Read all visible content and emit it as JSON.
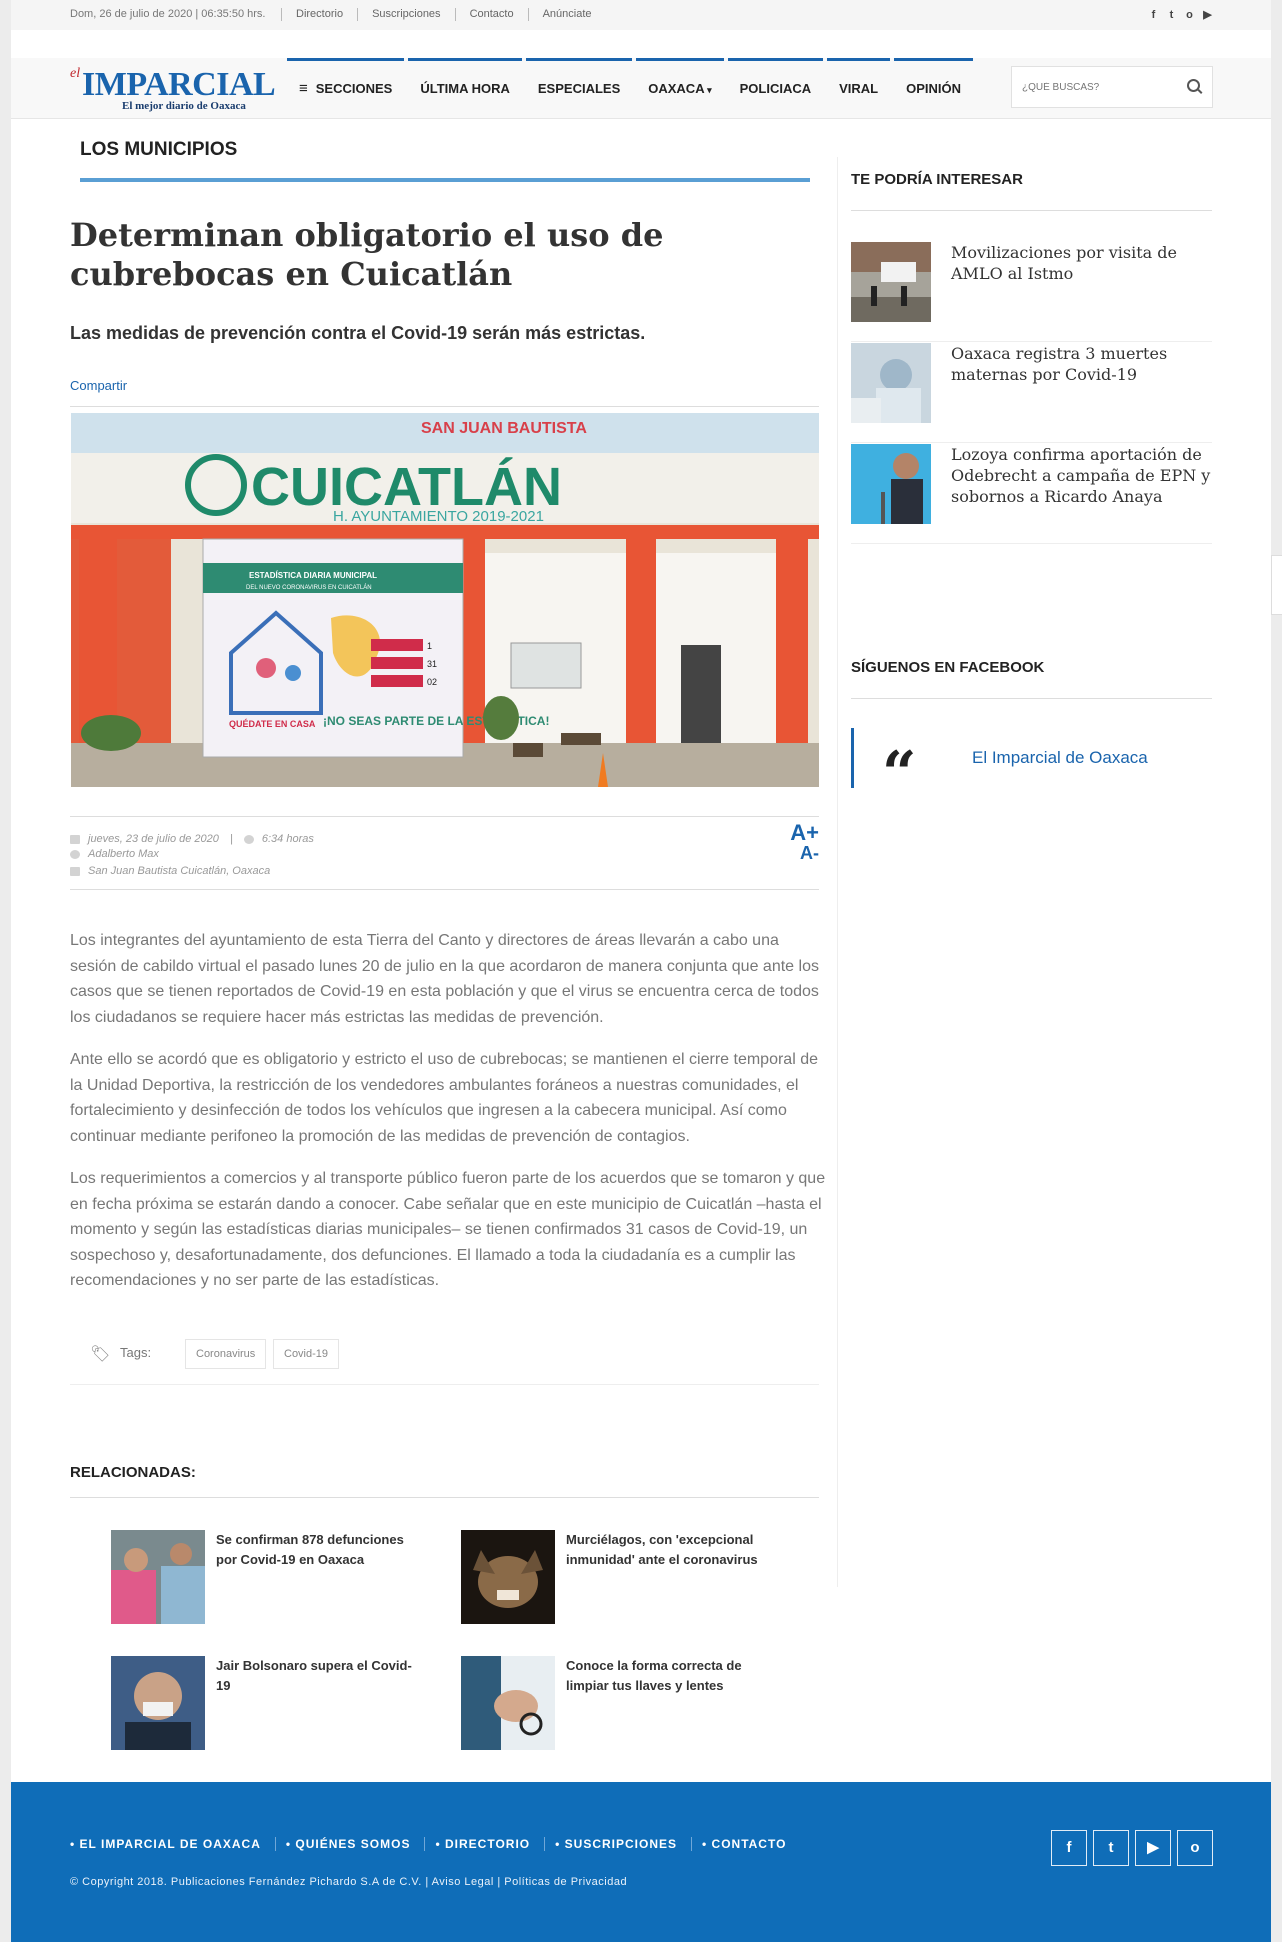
{
  "topbar": {
    "date": "Dom, 26 de julio de 2020 | 06:35:50 hrs.",
    "links": [
      "Directorio",
      "Suscripciones",
      "Contacto",
      "Anúnciate"
    ],
    "social": [
      "f",
      "t",
      "o",
      "▶"
    ]
  },
  "header": {
    "logo_prefix": "el",
    "logo": "IMPARCIAL",
    "tagline": "El mejor diario de Oaxaca",
    "nav": [
      "SECCIONES",
      "ÚLTIMA HORA",
      "ESPECIALES",
      "OAXACA",
      "POLICIACA",
      "VIRAL",
      "OPINIÓN"
    ],
    "search_placeholder": "¿QUÉ BUSCAS?"
  },
  "article": {
    "section": "LOS MUNICIPIOS",
    "title": "Determinan obligatorio el uso de cubrebocas en Cuicatlán",
    "subtitle": "Las medidas de prevención contra el Covid-19 serán más estrictas.",
    "share": "Compartir",
    "hero": {
      "banner_top": "SAN JUAN BAUTISTA",
      "banner_main": "CUICATLÁN",
      "banner_sub": "H. AYUNTAMIENTO 2019-2021",
      "poster_title": "ESTADÍSTICA DIARIA MUNICIPAL",
      "poster_sub": "DEL NUEVO CORONAVIRUS EN CUICATLÁN",
      "poster_slogan": "¡NO SEAS PARTE DE LA ESTADÍSTICA!",
      "poster_home": "QUÉDATE EN CASA",
      "poster_n1": "1",
      "poster_n2": "31",
      "poster_n3": "02"
    },
    "date": "jueves, 23 de julio de 2020",
    "time": "6:34 horas",
    "author": "Adalberto Max",
    "location": "San Juan Bautista Cuicatlán, Oaxaca",
    "font_plus": "A+",
    "font_minus": "A-",
    "paragraphs": [
      "Los integrantes del ayuntamiento de esta Tierra del Canto y directores de áreas llevarán a cabo una sesión de cabildo virtual el pasado lunes 20 de julio en la que acordaron de manera conjunta que ante los casos que se tienen reportados de Covid-19 en esta población y que el virus se encuentra cerca de todos los ciudadanos se requiere hacer más estrictas las medidas de prevención.",
      "Ante ello se acordó que es obligatorio y estricto el uso de cubrebocas; se mantienen el cierre temporal de la Unidad Deportiva, la restricción de los vendedores ambulantes foráneos a nuestras comunidades, el fortalecimiento y desinfección de todos los vehículos que ingresen a la cabecera municipal. Así como continuar mediante perifoneo la promoción de las medidas de prevención de contagios.",
      "Los requerimientos a comercios y al transporte público fueron parte de los acuerdos que se tomaron y que en fecha próxima se estarán dando a conocer. Cabe señalar que en este municipio de Cuicatlán –hasta el momento y según las estadísticas diarias municipales– se tienen confirmados 31 casos de Covid-19, un sospechoso y, desafortunadamente, dos defunciones. El llamado a toda la ciudadanía es a cumplir las recomendaciones y no ser parte de las estadísticas."
    ],
    "tags_label": "Tags:",
    "tags": [
      "Coronavirus",
      "Covid-19"
    ]
  },
  "related": {
    "title": "RELACIONADAS:",
    "items": [
      "Se confirman 878 defunciones por Covid-19 en Oaxaca",
      "Murciélagos, con 'excepcional inmunidad' ante el coronavirus",
      "Jair Bolsonaro supera el Covid-19",
      "Conoce la forma correcta de limpiar tus llaves y lentes"
    ]
  },
  "sidebar": {
    "interest_title": "TE PODRÍA INTERESAR",
    "items": [
      "Movilizaciones por visita de AMLO al Istmo",
      "Oaxaca registra 3 muertes maternas por Covid-19",
      "Lozoya confirma aportación de Odebrecht a campaña de EPN y sobornos a Ricardo Anaya"
    ],
    "facebook_title": "SÍGUENOS EN FACEBOOK",
    "facebook_name": "El Imparcial de Oaxaca"
  },
  "footer": {
    "links": [
      "• EL IMPARCIAL DE OAXACA",
      "• QUIÉNES SOMOS",
      "• DIRECTORIO",
      "• SUSCRIPCIONES",
      "• CONTACTO"
    ],
    "copyright": "© Copyright 2018. Publicaciones Fernández Pichardo S.A de C.V. | Aviso Legal | Políticas de Privacidad",
    "social": [
      "f",
      "t",
      "▶",
      "o"
    ]
  }
}
